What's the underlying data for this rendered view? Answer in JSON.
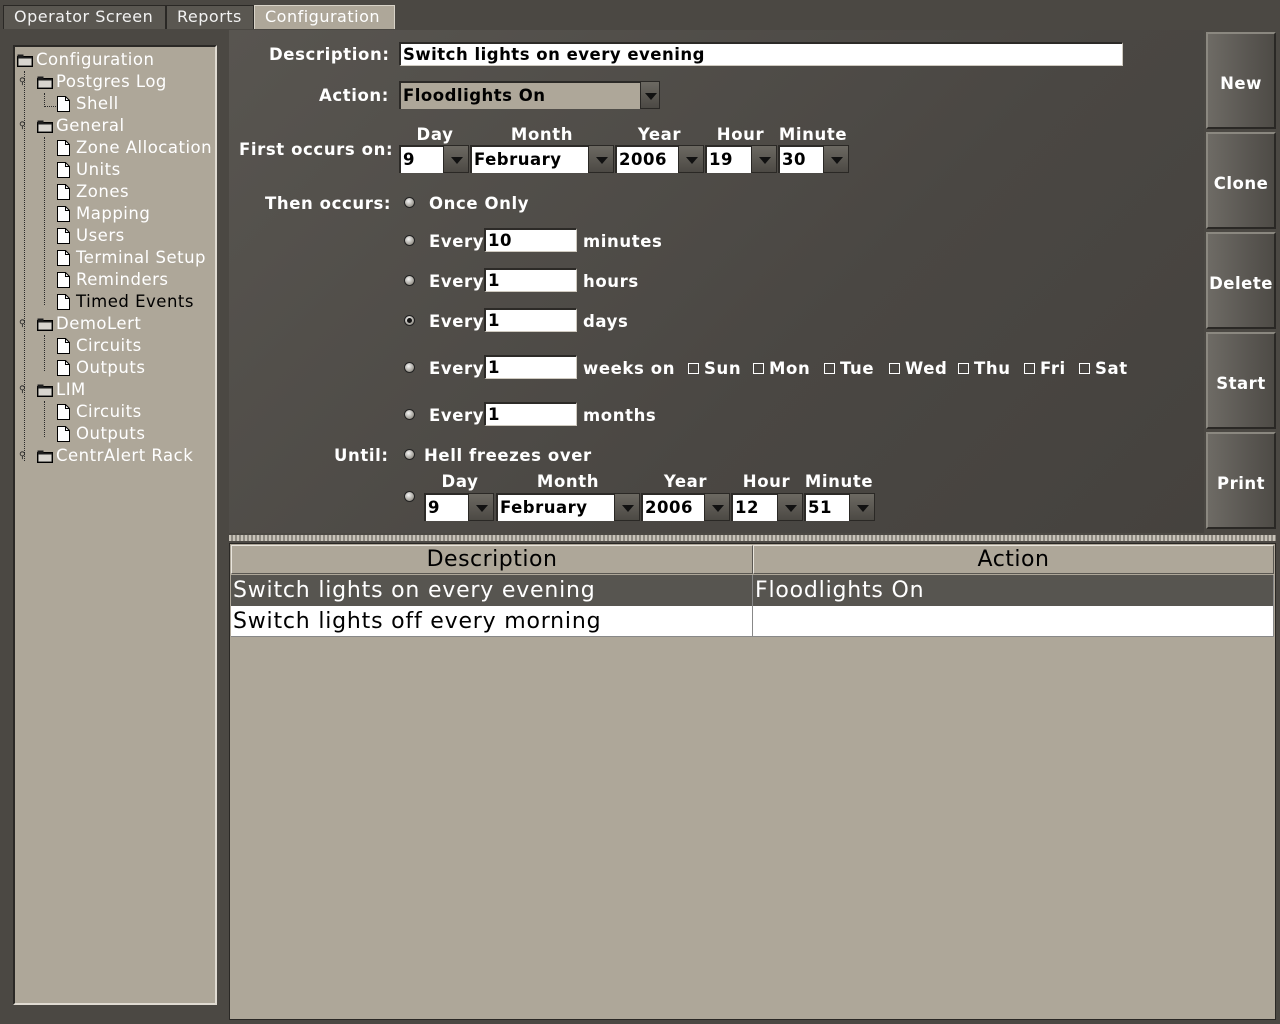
{
  "tabs": [
    "Operator Screen",
    "Reports",
    "Configuration"
  ],
  "active_tab": "Configuration",
  "tree": {
    "nodes": [
      {
        "label": "Configuration",
        "type": "folder"
      },
      {
        "label": "Postgres Log",
        "type": "folder"
      },
      {
        "label": "Shell",
        "type": "page"
      },
      {
        "label": "General",
        "type": "folder"
      },
      {
        "label": "Zone Allocation",
        "type": "page"
      },
      {
        "label": "Units",
        "type": "page"
      },
      {
        "label": "Zones",
        "type": "page"
      },
      {
        "label": "Mapping",
        "type": "page"
      },
      {
        "label": "Users",
        "type": "page"
      },
      {
        "label": "Terminal Setup",
        "type": "page"
      },
      {
        "label": "Reminders",
        "type": "page"
      },
      {
        "label": "Timed Events",
        "type": "page",
        "selected": true
      },
      {
        "label": "DemoLert",
        "type": "folder"
      },
      {
        "label": "Circuits",
        "type": "page"
      },
      {
        "label": "Outputs",
        "type": "page"
      },
      {
        "label": "LIM",
        "type": "folder"
      },
      {
        "label": "Circuits",
        "type": "page"
      },
      {
        "label": "Outputs",
        "type": "page"
      },
      {
        "label": "CentrAlert Rack",
        "type": "folder"
      }
    ]
  },
  "form": {
    "description_label": "Description:",
    "description_value": "Switch lights on every evening",
    "action_label": "Action:",
    "action_value": "Floodlights On",
    "first_occurs_label": "First occurs on:",
    "date_headers": {
      "day": "Day",
      "month": "Month",
      "year": "Year",
      "hour": "Hour",
      "minute": "Minute"
    },
    "first": {
      "day": "9",
      "month": "February",
      "year": "2006",
      "hour": "19",
      "minute": "30"
    },
    "then_occurs_label": "Then occurs:",
    "once_only": "Once Only",
    "every": "Every",
    "minutes_value": "10",
    "minutes_unit": "minutes",
    "hours_value": "1",
    "hours_unit": "hours",
    "days_value": "1",
    "days_unit": "days",
    "weeks_value": "1",
    "weeks_unit": "weeks on",
    "weekdays": [
      "Sun",
      "Mon",
      "Tue",
      "Wed",
      "Thu",
      "Fri",
      "Sat"
    ],
    "months_value": "1",
    "months_unit": "months",
    "selected_recurrence": "days",
    "until_label": "Until:",
    "until_never": "Hell freezes over",
    "until": {
      "day": "9",
      "month": "February",
      "year": "2006",
      "hour": "12",
      "minute": "51"
    }
  },
  "side_buttons": [
    "New",
    "Clone",
    "Delete",
    "Start",
    "Print"
  ],
  "table": {
    "columns": [
      "Description",
      "Action"
    ],
    "rows": [
      {
        "description": "Switch lights on every evening",
        "action": "Floodlights On",
        "selected": true
      },
      {
        "description": "Switch lights off every morning",
        "action": "",
        "selected": false
      }
    ]
  },
  "colors": {
    "panel": "#aea799",
    "background": "#4b4843",
    "selected_row": "#575550"
  }
}
